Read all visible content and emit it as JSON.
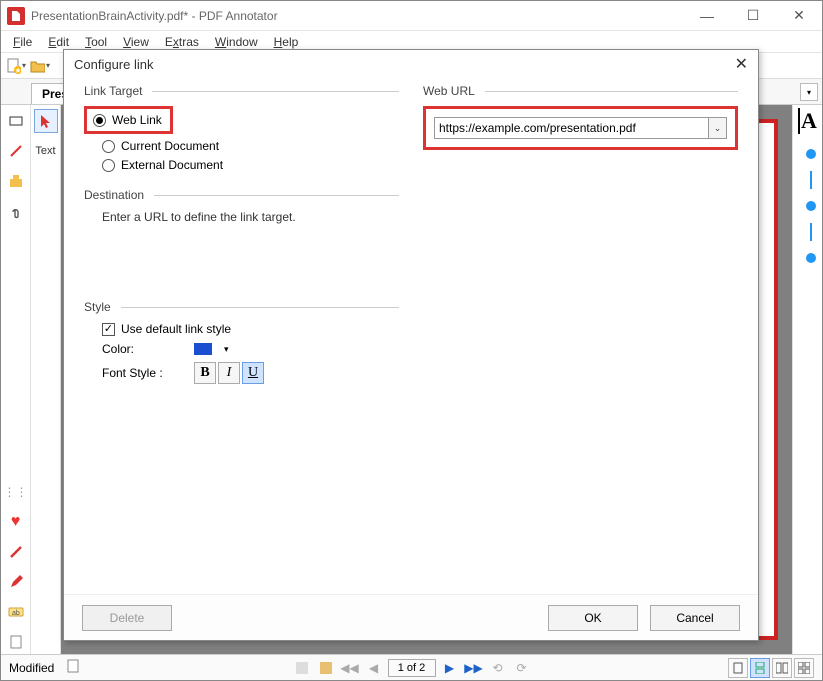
{
  "titlebar": {
    "title": "PresentationBrainActivity.pdf* - PDF Annotator"
  },
  "menu": {
    "file": "File",
    "edit": "Edit",
    "tool": "Tool",
    "view": "View",
    "extras": "Extras",
    "window": "Window",
    "help": "Help"
  },
  "tabs": {
    "active": "Prese"
  },
  "left_toolbar2": {
    "text_label": "Text"
  },
  "dialog": {
    "title": "Configure link",
    "link_target_label": "Link Target",
    "radio_web": "Web Link",
    "radio_current": "Current Document",
    "radio_external": "External Document",
    "web_url_label": "Web URL",
    "web_url_value": "https://example.com/presentation.pdf",
    "destination_label": "Destination",
    "destination_text": "Enter a URL to define the link target.",
    "style_label": "Style",
    "use_default_label": "Use default link style",
    "color_label": "Color:",
    "font_style_label": "Font Style :",
    "color_value": "#1b4fd1",
    "btn_delete": "Delete",
    "btn_ok": "OK",
    "btn_cancel": "Cancel"
  },
  "statusbar": {
    "modified": "Modified",
    "page": "1 of 2"
  },
  "right_tool": {
    "glyph": "A"
  }
}
